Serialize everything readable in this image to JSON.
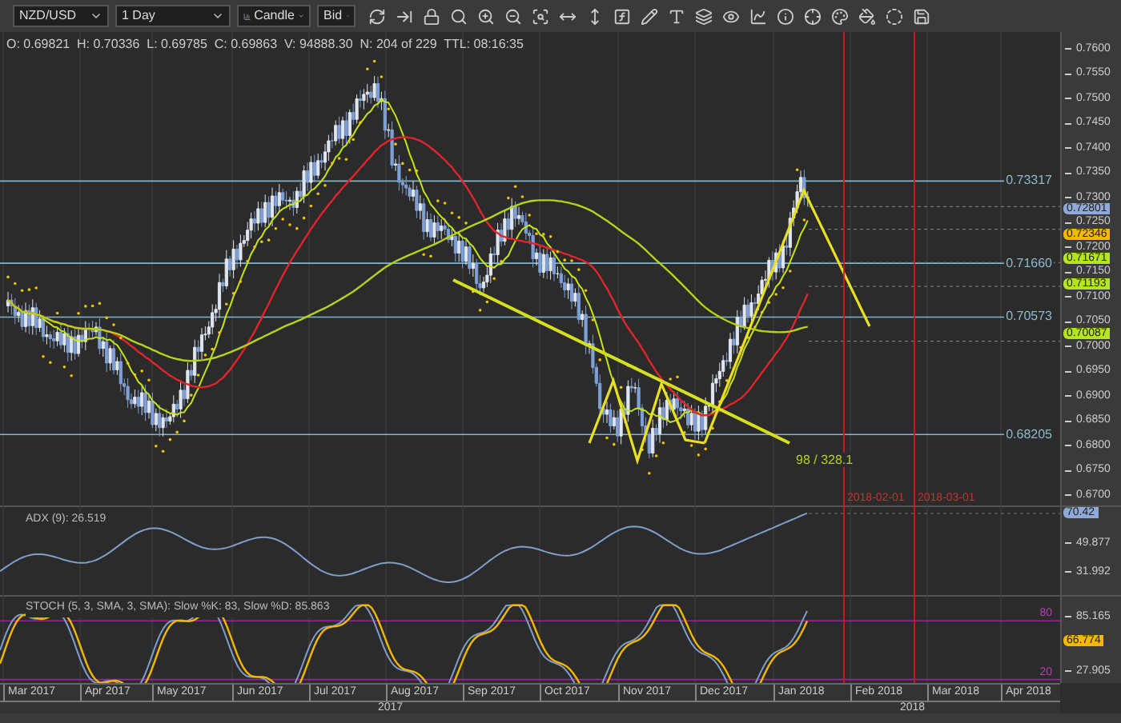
{
  "toolbar": {
    "symbol": "NZD/USD",
    "period": "1 Day",
    "chart_type": "Candle",
    "price_side": "Bid"
  },
  "info_line": "O: 0.69821  H: 0.70336  L: 0.69785  C: 0.69863  V: 94888.30  N: 204 of 229  TTL: 08:16:35",
  "price_chart": {
    "levels": [
      {
        "label": "0.73317"
      },
      {
        "label": "0.71660"
      },
      {
        "label": "0.70573"
      },
      {
        "label": "0.68205"
      }
    ],
    "annotation": "98 / 328.1",
    "event_markers": [
      {
        "label": "2018-02-01"
      },
      {
        "label": "2018-03-01"
      }
    ],
    "price_axis": {
      "ticks": [
        "0.7600",
        "0.7550",
        "0.7500",
        "0.7450",
        "0.7400",
        "0.7350",
        "0.7300",
        "0.7250",
        "0.7200",
        "0.7150",
        "0.7100",
        "0.7050",
        "0.7000",
        "0.6950",
        "0.6900",
        "0.6850",
        "0.6800",
        "0.6750",
        "0.6700"
      ]
    },
    "price_tags": [
      {
        "value": "0.72801",
        "color": "#8fa9d8"
      },
      {
        "value": "0.72346",
        "color": "#f5b800"
      },
      {
        "value": "0.71671",
        "color": "#b5e61d"
      },
      {
        "value": "0.71193",
        "color": "#b5e61d"
      },
      {
        "value": "0.70087",
        "color": "#b5e61d"
      }
    ]
  },
  "adx_panel": {
    "title": "ADX (9): 26.519",
    "axis_labels": [
      "49.877",
      "31.992"
    ],
    "value_tag": {
      "value": "70.42",
      "color": "#8fa9d8"
    }
  },
  "stoch_panel": {
    "title": "STOCH (5, 3, SMA, 3, SMA): Slow %K: 83, Slow %D: 85.863",
    "axis_labels": [
      "85.165",
      "27.905"
    ],
    "band_labels": [
      "80",
      "20"
    ],
    "value_tag": {
      "value": "66.774",
      "color": "#f5b800"
    }
  },
  "date_axis": {
    "months": [
      "Mar 2017",
      "Apr 2017",
      "May 2017",
      "Jun 2017",
      "Jul 2017",
      "Aug 2017",
      "Sep 2017",
      "Oct 2017",
      "Nov 2017",
      "Dec 2017",
      "Jan 2018",
      "Feb 2018",
      "Mar 2018",
      "Apr 2018"
    ],
    "years": [
      "2017",
      "2018"
    ]
  }
}
